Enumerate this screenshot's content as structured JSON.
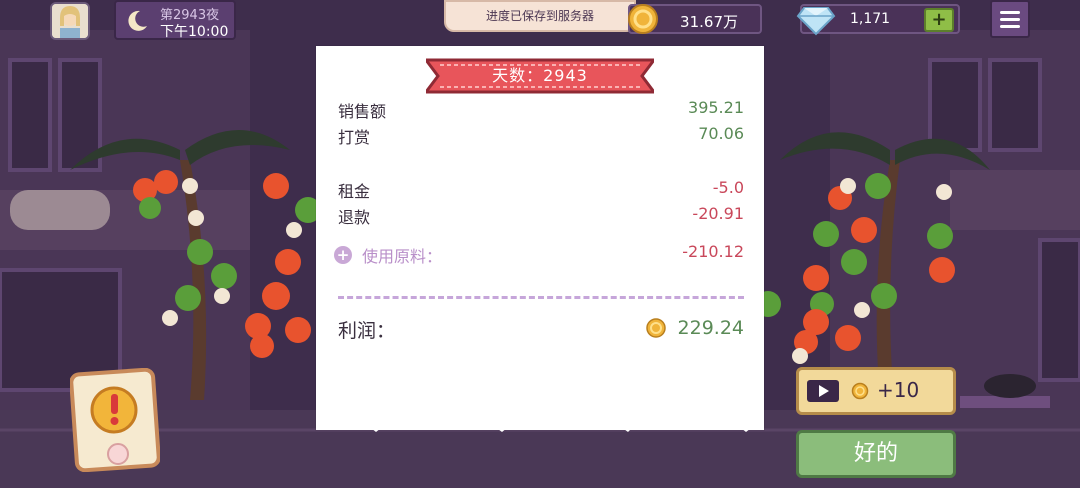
{
  "header": {
    "night_label": "第2943夜",
    "time_label": "下午10:00",
    "save_toast": "进度已保存到服务器",
    "coins": "31.67万",
    "gems": "1,171",
    "gem_add": "+"
  },
  "receipt": {
    "title": "天数：2943",
    "rows": [
      {
        "label": "销售额",
        "value": "395.21"
      },
      {
        "label": "打赏",
        "value": "70.06"
      },
      {
        "label": "租金",
        "value": "-5.0"
      },
      {
        "label": "退款",
        "value": "-20.91"
      }
    ],
    "ingredients_label": "使用原料：",
    "ingredients_value": "-210.12",
    "ingredients_toggle": "+",
    "profit_label": "利润：",
    "profit_value": "229.24"
  },
  "actions": {
    "ad_reward": "+10",
    "ok_label": "好的"
  },
  "colors": {
    "positive": "#5a8a56",
    "negative": "#c9475a",
    "ribbon": "#e8555b",
    "ok_button": "#8bbd7b",
    "ad_button": "#f2d99a"
  }
}
